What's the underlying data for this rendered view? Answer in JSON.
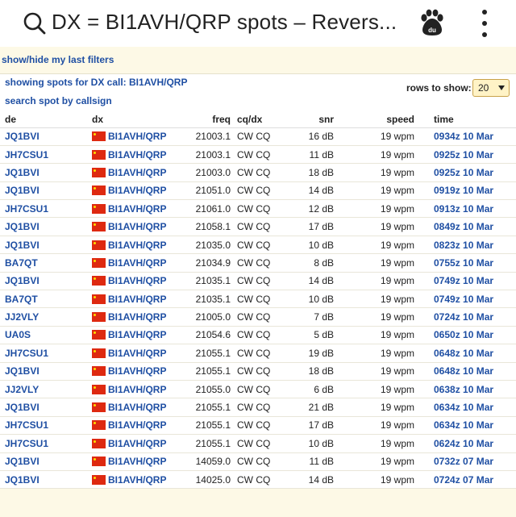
{
  "window": {
    "title": "DX = BI1AVH/QRP spots – Revers...",
    "search_icon": "search-icon",
    "baidu_icon": "baidu-paw-icon",
    "menu_icon": "more-vert-icon"
  },
  "filters": {
    "toggle_label": "show/hide my last filters"
  },
  "panel": {
    "showing_label": "showing spots for DX call: BI1AVH/QRP",
    "search_label": "search spot by callsign",
    "rows_label": "rows to show:",
    "rows_value": "20"
  },
  "table": {
    "headers": [
      "de",
      "dx",
      "freq",
      "cq/dx",
      "snr",
      "speed",
      "time"
    ],
    "rows": [
      {
        "de": "JQ1BVI",
        "dx": "BI1AVH/QRP",
        "freq": "21003.1",
        "mode": "CW CQ",
        "snr": "16 dB",
        "speed": "19 wpm",
        "time": "0934z 10 Mar"
      },
      {
        "de": "JH7CSU1",
        "dx": "BI1AVH/QRP",
        "freq": "21003.1",
        "mode": "CW CQ",
        "snr": "11 dB",
        "speed": "19 wpm",
        "time": "0925z 10 Mar"
      },
      {
        "de": "JQ1BVI",
        "dx": "BI1AVH/QRP",
        "freq": "21003.0",
        "mode": "CW CQ",
        "snr": "18 dB",
        "speed": "19 wpm",
        "time": "0925z 10 Mar"
      },
      {
        "de": "JQ1BVI",
        "dx": "BI1AVH/QRP",
        "freq": "21051.0",
        "mode": "CW CQ",
        "snr": "14 dB",
        "speed": "19 wpm",
        "time": "0919z 10 Mar"
      },
      {
        "de": "JH7CSU1",
        "dx": "BI1AVH/QRP",
        "freq": "21061.0",
        "mode": "CW CQ",
        "snr": "12 dB",
        "speed": "19 wpm",
        "time": "0913z 10 Mar"
      },
      {
        "de": "JQ1BVI",
        "dx": "BI1AVH/QRP",
        "freq": "21058.1",
        "mode": "CW CQ",
        "snr": "17 dB",
        "speed": "19 wpm",
        "time": "0849z 10 Mar"
      },
      {
        "de": "JQ1BVI",
        "dx": "BI1AVH/QRP",
        "freq": "21035.0",
        "mode": "CW CQ",
        "snr": "10 dB",
        "speed": "19 wpm",
        "time": "0823z 10 Mar"
      },
      {
        "de": "BA7QT",
        "dx": "BI1AVH/QRP",
        "freq": "21034.9",
        "mode": "CW CQ",
        "snr": "8 dB",
        "speed": "19 wpm",
        "time": "0755z 10 Mar"
      },
      {
        "de": "JQ1BVI",
        "dx": "BI1AVH/QRP",
        "freq": "21035.1",
        "mode": "CW CQ",
        "snr": "14 dB",
        "speed": "19 wpm",
        "time": "0749z 10 Mar"
      },
      {
        "de": "BA7QT",
        "dx": "BI1AVH/QRP",
        "freq": "21035.1",
        "mode": "CW CQ",
        "snr": "10 dB",
        "speed": "19 wpm",
        "time": "0749z 10 Mar"
      },
      {
        "de": "JJ2VLY",
        "dx": "BI1AVH/QRP",
        "freq": "21005.0",
        "mode": "CW CQ",
        "snr": "7 dB",
        "speed": "19 wpm",
        "time": "0724z 10 Mar"
      },
      {
        "de": "UA0S",
        "dx": "BI1AVH/QRP",
        "freq": "21054.6",
        "mode": "CW CQ",
        "snr": "5 dB",
        "speed": "19 wpm",
        "time": "0650z 10 Mar"
      },
      {
        "de": "JH7CSU1",
        "dx": "BI1AVH/QRP",
        "freq": "21055.1",
        "mode": "CW CQ",
        "snr": "19 dB",
        "speed": "19 wpm",
        "time": "0648z 10 Mar"
      },
      {
        "de": "JQ1BVI",
        "dx": "BI1AVH/QRP",
        "freq": "21055.1",
        "mode": "CW CQ",
        "snr": "18 dB",
        "speed": "19 wpm",
        "time": "0648z 10 Mar"
      },
      {
        "de": "JJ2VLY",
        "dx": "BI1AVH/QRP",
        "freq": "21055.0",
        "mode": "CW CQ",
        "snr": "6 dB",
        "speed": "19 wpm",
        "time": "0638z 10 Mar"
      },
      {
        "de": "JQ1BVI",
        "dx": "BI1AVH/QRP",
        "freq": "21055.1",
        "mode": "CW CQ",
        "snr": "21 dB",
        "speed": "19 wpm",
        "time": "0634z 10 Mar"
      },
      {
        "de": "JH7CSU1",
        "dx": "BI1AVH/QRP",
        "freq": "21055.1",
        "mode": "CW CQ",
        "snr": "17 dB",
        "speed": "19 wpm",
        "time": "0634z 10 Mar"
      },
      {
        "de": "JH7CSU1",
        "dx": "BI1AVH/QRP",
        "freq": "21055.1",
        "mode": "CW CQ",
        "snr": "10 dB",
        "speed": "19 wpm",
        "time": "0624z 10 Mar"
      },
      {
        "de": "JQ1BVI",
        "dx": "BI1AVH/QRP",
        "freq": "14059.0",
        "mode": "CW CQ",
        "snr": "11 dB",
        "speed": "19 wpm",
        "time": "0732z 07 Mar"
      },
      {
        "de": "JQ1BVI",
        "dx": "BI1AVH/QRP",
        "freq": "14025.0",
        "mode": "CW CQ",
        "snr": "14 dB",
        "speed": "19 wpm",
        "time": "0724z 07 Mar"
      }
    ]
  }
}
